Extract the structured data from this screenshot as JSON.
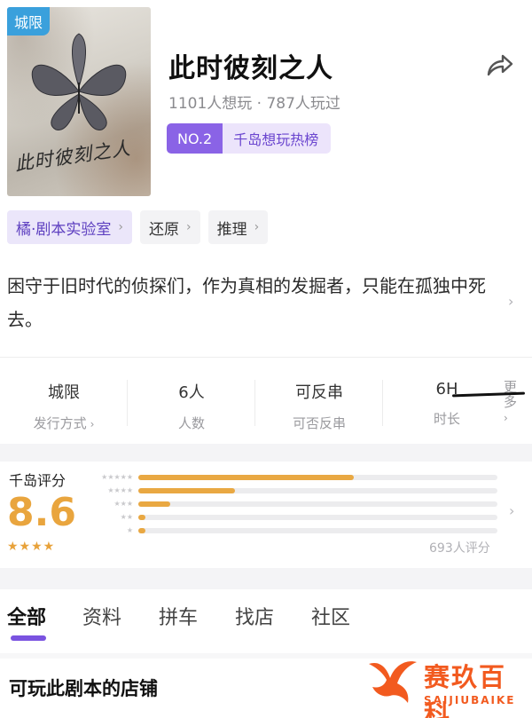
{
  "cover": {
    "tag": "城限",
    "art_text": "此时彼刻之人",
    "colors": {
      "tag_bg": "#3aa0dc",
      "accent_red": "#c0392b"
    }
  },
  "header": {
    "title": "此时彼刻之人",
    "stats": "1101人想玩 · 787人玩过",
    "rank": {
      "no": "NO.2",
      "text": "千岛想玩热榜"
    },
    "share_icon": "share-icon"
  },
  "tags": [
    {
      "label": "橘·剧本实验室"
    },
    {
      "label": "还原"
    },
    {
      "label": "推理"
    }
  ],
  "intro": {
    "text": "困守于旧时代的侦探们，作为真相的发掘者，只能在孤独中死去。"
  },
  "info": [
    {
      "value": "城限",
      "label": "发行方式"
    },
    {
      "value": "6人",
      "label": "人数"
    },
    {
      "value": "可反串",
      "label": "可否反串"
    },
    {
      "value": "6H",
      "label": "时长"
    }
  ],
  "more": {
    "label": "更多"
  },
  "rating": {
    "label": "千岛评分",
    "score": "8.6",
    "stars_display": "★★★★",
    "count": "693人评分",
    "distribution": [
      {
        "stars": 5,
        "fraction": 0.6
      },
      {
        "stars": 4,
        "fraction": 0.27
      },
      {
        "stars": 3,
        "fraction": 0.09
      },
      {
        "stars": 2,
        "fraction": 0.02
      },
      {
        "stars": 1,
        "fraction": 0.02
      }
    ],
    "colors": {
      "score": "#e9a53e",
      "bar": "#e9a842"
    }
  },
  "tabs": [
    {
      "label": "全部",
      "active": true
    },
    {
      "label": "资料",
      "active": false
    },
    {
      "label": "拼车",
      "active": false
    },
    {
      "label": "找店",
      "active": false
    },
    {
      "label": "社区",
      "active": false
    }
  ],
  "section": {
    "title": "可玩此剧本的店铺"
  },
  "watermark": {
    "title": "赛玖百科",
    "subtitle": "SAIJIUBAIKE"
  },
  "theme": {
    "purple": "#7a53e0",
    "purple_light": "#ece4fb"
  }
}
